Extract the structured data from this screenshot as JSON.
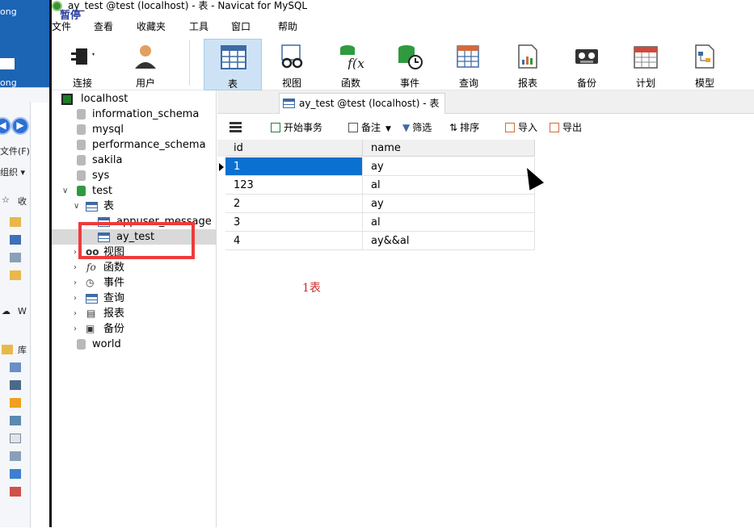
{
  "window": {
    "title": "ay_test @test (localhost) - 表 - Navicat for MySQL",
    "overlay_label": "暂停"
  },
  "desktop": {
    "texts": [
      "ong",
      "ong"
    ],
    "explorer": {
      "menu_file": "文件(F)",
      "menu_organize": "组织 ▾",
      "favorites": "收",
      "onedrive": "W",
      "library": "库"
    }
  },
  "menubar": [
    "文件",
    "查看",
    "收藏夹",
    "工具",
    "窗口",
    "帮助"
  ],
  "toolbar": [
    {
      "label": "连接",
      "icon": "connection-plug-icon"
    },
    {
      "label": "用户",
      "icon": "user-icon"
    },
    {
      "label": "表",
      "icon": "table-icon",
      "active": true
    },
    {
      "label": "视图",
      "icon": "view-glasses-icon"
    },
    {
      "label": "函数",
      "icon": "function-icon"
    },
    {
      "label": "事件",
      "icon": "event-icon"
    },
    {
      "label": "查询",
      "icon": "query-icon"
    },
    {
      "label": "报表",
      "icon": "report-icon"
    },
    {
      "label": "备份",
      "icon": "backup-icon"
    },
    {
      "label": "计划",
      "icon": "schedule-icon"
    },
    {
      "label": "模型",
      "icon": "model-icon"
    }
  ],
  "sidebar": {
    "connection": "localhost",
    "databases": [
      "information_schema",
      "mysql",
      "performance_schema",
      "sakila",
      "sys"
    ],
    "open_db": "test",
    "tables_group": "表",
    "tables": [
      "appuser_message",
      "ay_test"
    ],
    "groups": [
      "视图",
      "函数",
      "事件",
      "查询",
      "报表",
      "备份"
    ],
    "after_db": "world"
  },
  "tab": {
    "label": "ay_test @test (localhost) - 表"
  },
  "table_toolbar": {
    "begin_transaction": "开始事务",
    "memo": "备注",
    "filter": "筛选",
    "sort": "排序",
    "import": "导入",
    "export": "导出"
  },
  "grid": {
    "columns": [
      "id",
      "name"
    ],
    "rows": [
      [
        "1",
        "ay"
      ],
      [
        "123",
        "al"
      ],
      [
        "2",
        "ay"
      ],
      [
        "3",
        "al"
      ],
      [
        "4",
        "ay&&al"
      ]
    ],
    "selected_row": 0
  },
  "annotation": "1表",
  "colors": {
    "selection": "#0a71d1",
    "highlight_box": "#ee3b3b",
    "active_tool": "#cde3f5"
  }
}
